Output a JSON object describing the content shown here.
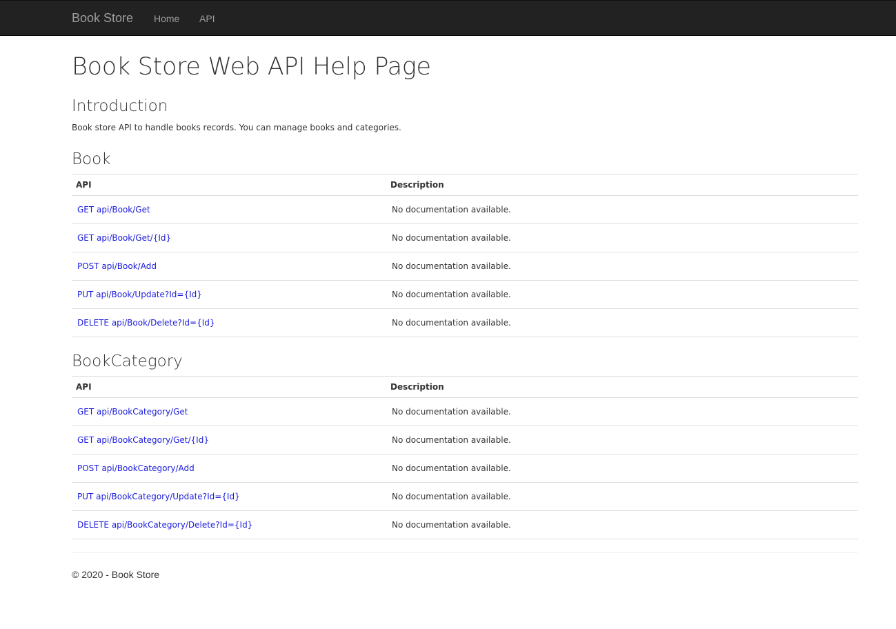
{
  "navbar": {
    "brand": "Book Store",
    "links": [
      "Home",
      "API"
    ],
    "background": "#222222",
    "link_color": "#9d9d9d"
  },
  "page_title": "Book Store Web API Help Page",
  "introduction": {
    "heading": "Introduction",
    "text": "Book store API to handle books records. You can manage books and categories."
  },
  "sections": [
    {
      "heading": "Book",
      "columns": [
        "API",
        "Description"
      ],
      "rows": [
        {
          "api": "GET api/Book/Get",
          "description": "No documentation available."
        },
        {
          "api": "GET api/Book/Get/{Id}",
          "description": "No documentation available."
        },
        {
          "api": "POST api/Book/Add",
          "description": "No documentation available."
        },
        {
          "api": "PUT api/Book/Update?Id={Id}",
          "description": "No documentation available."
        },
        {
          "api": "DELETE api/Book/Delete?Id={Id}",
          "description": "No documentation available."
        }
      ]
    },
    {
      "heading": "BookCategory",
      "columns": [
        "API",
        "Description"
      ],
      "rows": [
        {
          "api": "GET api/BookCategory/Get",
          "description": "No documentation available."
        },
        {
          "api": "GET api/BookCategory/Get/{Id}",
          "description": "No documentation available."
        },
        {
          "api": "POST api/BookCategory/Add",
          "description": "No documentation available."
        },
        {
          "api": "PUT api/BookCategory/Update?Id={Id}",
          "description": "No documentation available."
        },
        {
          "api": "DELETE api/BookCategory/Delete?Id={Id}",
          "description": "No documentation available."
        }
      ]
    }
  ],
  "footer": "© 2020 - Book Store",
  "link_color": "#1a1adc"
}
